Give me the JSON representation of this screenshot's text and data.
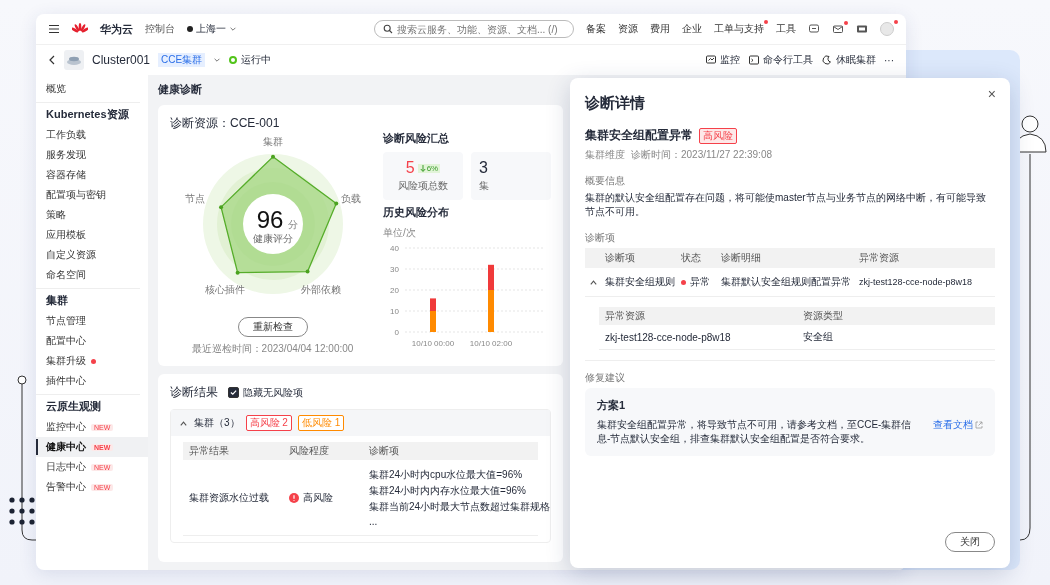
{
  "topbar": {
    "brand": "华为云",
    "console": "控制台",
    "region": "上海一",
    "search_placeholder": "搜索云服务、功能、资源、文档... (/)",
    "nav": [
      {
        "label": "备案",
        "dot": false
      },
      {
        "label": "资源",
        "dot": false
      },
      {
        "label": "费用",
        "dot": false
      },
      {
        "label": "企业",
        "dot": false
      },
      {
        "label": "工单与支持",
        "dot": true
      },
      {
        "label": "工具",
        "dot": false
      }
    ],
    "icons": [
      {
        "kind": "chat",
        "dot": false
      },
      {
        "kind": "mail",
        "dot": true
      },
      {
        "kind": "screen",
        "dot": false
      }
    ],
    "avatar": {
      "dot": true
    }
  },
  "cluster_bar": {
    "name": "Cluster001",
    "tag": "CCE集群",
    "status": "运行中",
    "actions": [
      {
        "kind": "monitor",
        "label": "监控"
      },
      {
        "kind": "terminal",
        "label": "命令行工具"
      },
      {
        "kind": "sleep",
        "label": "休眠集群"
      }
    ],
    "more": "···"
  },
  "sidebar": {
    "items": [
      {
        "kind": "link",
        "label": "概览",
        "selected": false
      },
      {
        "kind": "header",
        "label": "Kubernetes资源"
      },
      {
        "kind": "link",
        "label": "工作负载",
        "selected": false
      },
      {
        "kind": "link",
        "label": "服务发现",
        "selected": false
      },
      {
        "kind": "link",
        "label": "容器存储",
        "selected": false
      },
      {
        "kind": "link",
        "label": "配置项与密钥",
        "selected": false
      },
      {
        "kind": "link",
        "label": "策略",
        "selected": false
      },
      {
        "kind": "link",
        "label": "应用模板",
        "selected": false
      },
      {
        "kind": "link",
        "label": "自定义资源",
        "selected": false
      },
      {
        "kind": "link",
        "label": "命名空间",
        "selected": false
      },
      {
        "kind": "header",
        "label": "集群"
      },
      {
        "kind": "link",
        "label": "节点管理",
        "selected": false
      },
      {
        "kind": "link",
        "label": "配置中心",
        "selected": false
      },
      {
        "kind": "link",
        "label": "集群升级",
        "selected": false,
        "dot": true
      },
      {
        "kind": "link",
        "label": "插件中心",
        "selected": false
      },
      {
        "kind": "header",
        "label": "云原生观测"
      },
      {
        "kind": "link",
        "label": "监控中心",
        "selected": false,
        "badge": "NEW"
      },
      {
        "kind": "link",
        "label": "健康中心",
        "selected": true,
        "badge": "NEW"
      },
      {
        "kind": "link",
        "label": "日志中心",
        "selected": false,
        "badge": "NEW"
      },
      {
        "kind": "link",
        "label": "告警中心",
        "selected": false,
        "badge": "NEW"
      }
    ]
  },
  "main": {
    "title": "健康诊断",
    "overview": {
      "resource": "诊断资源：CCE-001",
      "radar": {
        "axes": [
          "集群",
          "负载",
          "外部依赖",
          "核心插件",
          "节点"
        ],
        "score": "96",
        "unit": "分",
        "score_label": "健康评分"
      },
      "recheck_button": "重新检查",
      "last_check": "最近巡检时间：2023/04/04 12:00:00",
      "risk_summary": {
        "title": "诊断风险汇总",
        "cards": [
          {
            "value": "5",
            "color": "#f5414a",
            "change": "6%",
            "label": "风险项总数"
          },
          {
            "value": "3",
            "color": "#252b3a",
            "label": "集"
          }
        ]
      },
      "history": {
        "title": "历史风险分布",
        "chart_data": {
          "type": "bar",
          "stacked": true,
          "grid": true,
          "ylabel": "单位/次",
          "categories": [
            "10/10 00:00",
            "10/10 02:00"
          ],
          "ylim": [
            0,
            40
          ],
          "yticks": [
            0,
            10,
            20,
            30,
            40
          ],
          "series": [
            {
              "color": "#ff8a00",
              "values": [
                10,
                20
              ]
            },
            {
              "color": "#f03a3a",
              "values": [
                6,
                12
              ]
            }
          ]
        }
      }
    },
    "results": {
      "title": "诊断结果",
      "hide_no_risk": {
        "label": "隐藏无风险项",
        "checked": true
      },
      "groups": [
        {
          "label": "集群（3）",
          "expanded": true,
          "tags": [
            {
              "label": "高风险 2",
              "color": "#f5414a"
            },
            {
              "label": "低风险 1",
              "color": "#ff8a00"
            }
          ],
          "columns": [
            "异常结果",
            "风险程度",
            "诊断项"
          ],
          "rows": [
            {
              "result": "集群资源水位过载",
              "risk": "高风险",
              "items": [
                "集群24小时内cpu水位最大值=96%",
                "集群24小时内内存水位最大值=96%",
                "集群当前24小时最大节点数超过集群规格",
                "..."
              ]
            }
          ]
        }
      ]
    }
  },
  "modal": {
    "title": "诊断详情",
    "close": "×",
    "heading": "集群安全组配置异常",
    "severity": "高风险",
    "meta": [
      "集群维度",
      "诊断时间：2023/11/27 22:39:08"
    ],
    "summary_label": "概要信息",
    "summary": "集群的默认安全组配置存在问题，将可能使master节点与业务节点的网络中断，有可能导致节点不可用。",
    "items_label": "诊断项",
    "columns": [
      "诊断项",
      "状态",
      "诊断明细",
      "异常资源"
    ],
    "rows": [
      {
        "expanded": true,
        "item": "集群安全组规则",
        "status": "异常",
        "detail": "集群默认安全组规则配置异常",
        "resource": "zkj-test128-cce-node-p8w18",
        "sub_columns": [
          "异常资源",
          "资源类型"
        ],
        "sub_rows": [
          [
            "zkj-test128-cce-node-p8w18",
            "安全组"
          ]
        ]
      }
    ],
    "fix_label": "修复建议",
    "plans": [
      {
        "title": "方案1",
        "text": "集群安全组配置异常，将导致节点不可用，请参考文档，至CCE-集群信息-节点默认安全组，排查集群默认安全组配置是否符合要求。",
        "link": "查看文档"
      }
    ],
    "close_button": "关闭"
  }
}
